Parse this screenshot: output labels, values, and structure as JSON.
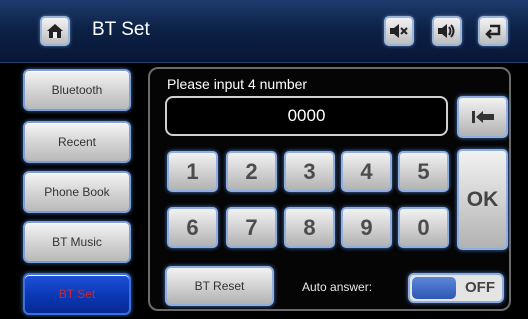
{
  "header": {
    "title": "BT Set",
    "home_icon": "home-icon",
    "mute_icon": "speaker-mute-icon",
    "volume_icon": "speaker-volume-icon",
    "back_icon": "return-arrow-icon"
  },
  "sidebar": {
    "items": [
      {
        "label": "Bluetooth"
      },
      {
        "label": "Recent"
      },
      {
        "label": "Phone Book"
      },
      {
        "label": "BT Music"
      },
      {
        "label": "BT Set"
      }
    ]
  },
  "pin": {
    "prompt": "Please input 4 number",
    "value": "0000",
    "keys": [
      "1",
      "2",
      "3",
      "4",
      "5",
      "6",
      "7",
      "8",
      "9",
      "0"
    ],
    "ok_label": "OK",
    "backspace_icon": "backspace-arrow-icon"
  },
  "footer": {
    "reset_label": "BT Reset",
    "auto_answer_label": "Auto answer:",
    "auto_answer_state": "OFF"
  },
  "colors": {
    "header_bg": "#0d2247",
    "active_tab": "#0b37b5",
    "active_tab_text": "#c9282e",
    "button_border": "#8eaee0"
  }
}
